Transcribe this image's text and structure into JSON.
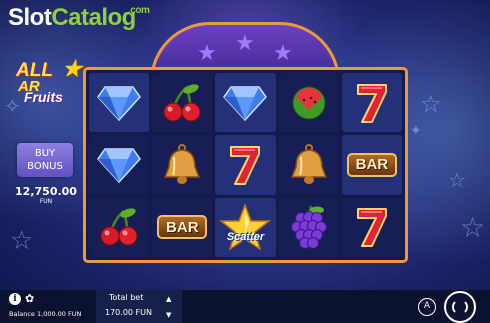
{
  "site": {
    "logo_part1": "Slot",
    "logo_part2": "Catalog",
    "logo_suffix": ".com"
  },
  "game": {
    "logo_line1": "ALL",
    "logo_line1_rest": "AR",
    "logo_line2": "Fruits"
  },
  "side_panel": {
    "buy_line1": "BUY",
    "buy_line2": "BONUS",
    "balance_value": "12,750.00",
    "balance_unit": "FUN"
  },
  "reels": {
    "symbols": [
      [
        "diamond",
        "cherry",
        "diamond",
        "watermelon",
        "seven"
      ],
      [
        "diamond",
        "bell",
        "seven",
        "bell",
        "bar"
      ],
      [
        "cherry",
        "bar",
        "scatter",
        "grapes",
        "seven"
      ]
    ],
    "bar_label": "BAR",
    "scatter_label": "Scatter"
  },
  "bottom": {
    "balance_text": "Balance 1,000.00 FUN",
    "total_bet_label": "Total bet",
    "total_bet_value": "170.00 FUN",
    "auto_label": "A",
    "info_label": "i",
    "gear_glyph": "✿"
  },
  "colors": {
    "accent_orange": "#e99a3c",
    "brand_green": "#8fd13a",
    "button_purple": "#6152c4"
  }
}
